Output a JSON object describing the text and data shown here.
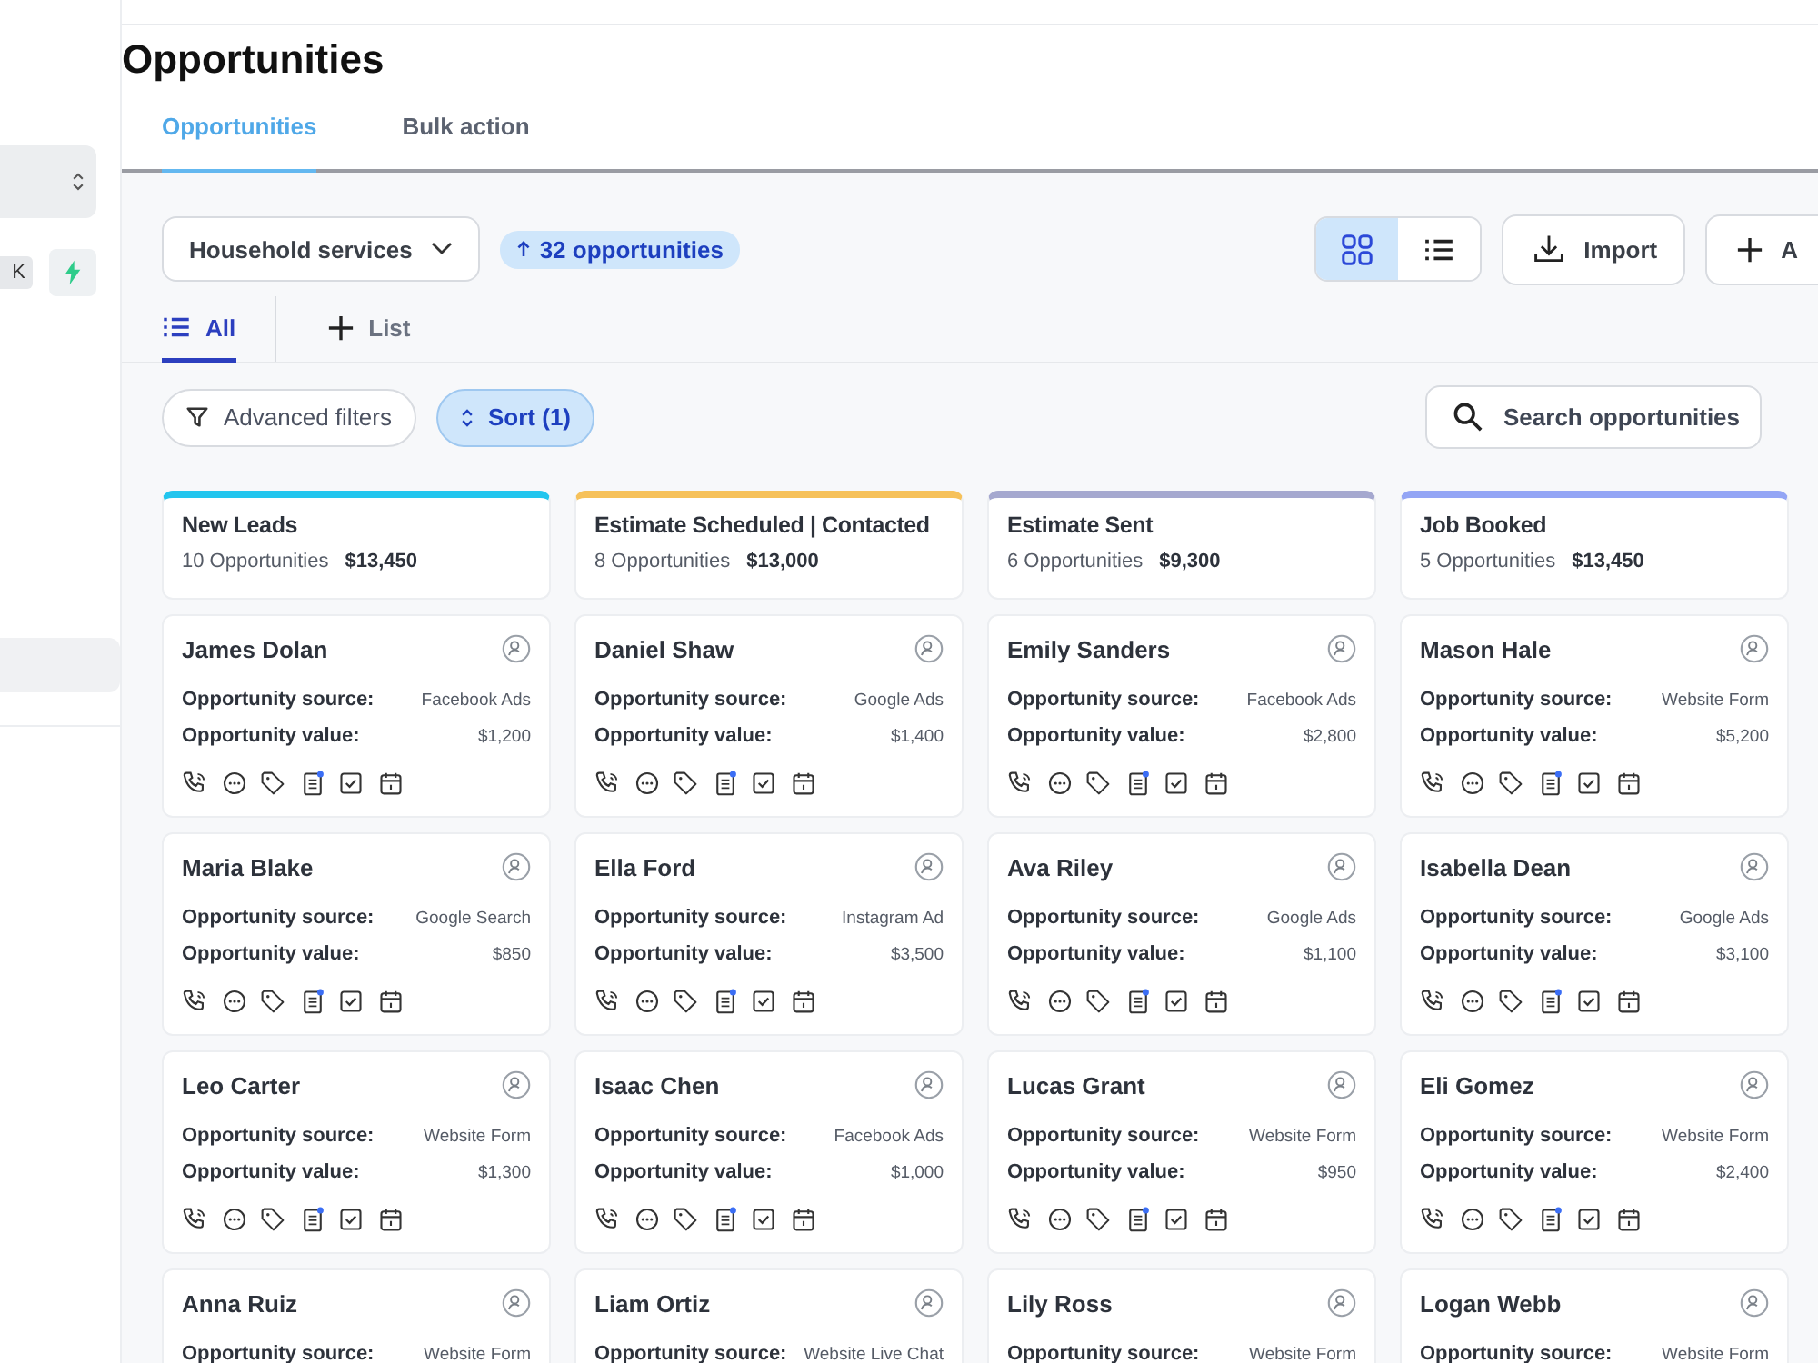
{
  "sidebar": {
    "shortcut_key": "K",
    "highlighted_item": {
      "selected": true
    }
  },
  "page": {
    "title": "Opportunities"
  },
  "tabs": [
    {
      "label": "Opportunities",
      "selected": true
    },
    {
      "label": "Bulk action",
      "selected": false
    }
  ],
  "pipeline": {
    "name": "Household services"
  },
  "count_badge": "32 opportunities",
  "views": [
    {
      "kind": "grid",
      "selected": true
    },
    {
      "kind": "list",
      "selected": false
    }
  ],
  "actions": [
    {
      "kind": "import",
      "label": "Import"
    },
    {
      "kind": "add",
      "label": "A"
    }
  ],
  "list_tabs": [
    {
      "kind": "all",
      "label": "All",
      "selected": true
    },
    {
      "kind": "add",
      "label": "List",
      "selected": false
    }
  ],
  "filters": [
    {
      "kind": "filter",
      "label": "Advanced filters",
      "selected": false
    },
    {
      "kind": "sort",
      "label": "Sort (1)",
      "selected": true
    }
  ],
  "search": {
    "placeholder": "Search opportunities"
  },
  "columns": [
    {
      "title": "New Leads",
      "count": "10 Opportunities",
      "total": "$13,450",
      "color": "#22c5ee",
      "cards": [
        {
          "name": "James Dolan",
          "source_label": "Opportunity source:",
          "source": "Facebook Ads",
          "value_label": "Opportunity value:",
          "value": "$1,200"
        },
        {
          "name": "Maria Blake",
          "source_label": "Opportunity source:",
          "source": "Google Search",
          "value_label": "Opportunity value:",
          "value": "$850"
        },
        {
          "name": "Leo Carter",
          "source_label": "Opportunity source:",
          "source": "Website Form",
          "value_label": "Opportunity value:",
          "value": "$1,300"
        },
        {
          "name": "Anna Ruiz",
          "source_label": "Opportunity source:",
          "source": "Website Form"
        }
      ]
    },
    {
      "title": "Estimate Scheduled | Contacted",
      "count": "8 Opportunities",
      "total": "$13,000",
      "color": "#f6c15a",
      "cards": [
        {
          "name": "Daniel Shaw",
          "source_label": "Opportunity source:",
          "source": "Google Ads",
          "value_label": "Opportunity value:",
          "value": "$1,400"
        },
        {
          "name": "Ella Ford",
          "source_label": "Opportunity source:",
          "source": "Instagram Ad",
          "value_label": "Opportunity value:",
          "value": "$3,500"
        },
        {
          "name": "Isaac Chen",
          "source_label": "Opportunity source:",
          "source": "Facebook Ads",
          "value_label": "Opportunity value:",
          "value": "$1,000"
        },
        {
          "name": "Liam Ortiz",
          "source_label": "Opportunity source:",
          "source": "Website Live Chat"
        }
      ]
    },
    {
      "title": "Estimate Sent",
      "count": "6 Opportunities",
      "total": "$9,300",
      "color": "#a5a8cf",
      "cards": [
        {
          "name": "Emily Sanders",
          "source_label": "Opportunity source:",
          "source": "Facebook Ads",
          "value_label": "Opportunity value:",
          "value": "$2,800"
        },
        {
          "name": "Ava Riley",
          "source_label": "Opportunity source:",
          "source": "Google Ads",
          "value_label": "Opportunity value:",
          "value": "$1,100"
        },
        {
          "name": "Lucas Grant",
          "source_label": "Opportunity source:",
          "source": "Website Form",
          "value_label": "Opportunity value:",
          "value": "$950"
        },
        {
          "name": "Lily Ross",
          "source_label": "Opportunity source:",
          "source": "Website Form"
        }
      ]
    },
    {
      "title": "Job Booked",
      "count": "5 Opportunities",
      "total": "$13,450",
      "color": "#93a5f5",
      "cards": [
        {
          "name": "Mason Hale",
          "source_label": "Opportunity source:",
          "source": "Website Form",
          "value_label": "Opportunity value:",
          "value": "$5,200"
        },
        {
          "name": "Isabella Dean",
          "source_label": "Opportunity source:",
          "source": "Google Ads",
          "value_label": "Opportunity value:",
          "value": "$3,100"
        },
        {
          "name": "Eli Gomez",
          "source_label": "Opportunity source:",
          "source": "Website Form",
          "value_label": "Opportunity value:",
          "value": "$2,400"
        },
        {
          "name": "Logan Webb",
          "source_label": "Opportunity source:",
          "source": "Website Form"
        }
      ]
    }
  ]
}
